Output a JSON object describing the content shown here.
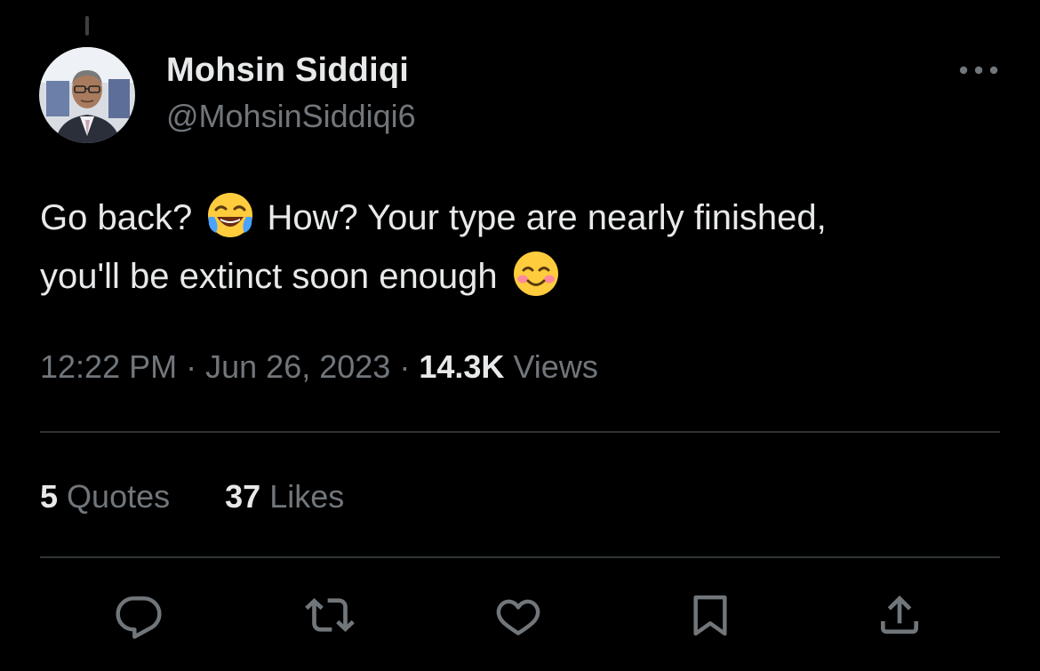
{
  "author": {
    "display_name": "Mohsin Siddiqi",
    "handle": "@MohsinSiddiqi6"
  },
  "tweet": {
    "text_line1_a": "Go back?",
    "emoji1": "face-with-tears-of-joy",
    "text_line1_b": "How? Your type are nearly finished,",
    "text_line2": "you'll be extinct soon enough",
    "emoji2": "smiling-face-with-blush"
  },
  "meta": {
    "time": "12:22 PM",
    "separator": "·",
    "date": "Jun 26, 2023",
    "views_count": "14.3K",
    "views_label": "Views"
  },
  "stats": {
    "quotes_count": "5",
    "quotes_label": "Quotes",
    "likes_count": "37",
    "likes_label": "Likes"
  },
  "actions": {
    "icons": [
      "reply-icon",
      "retweet-icon",
      "like-icon",
      "bookmark-icon",
      "share-icon"
    ]
  },
  "colors": {
    "background": "#000000",
    "primary_text": "#e7e9ea",
    "secondary_text": "#71767b",
    "divider": "#2f3336"
  }
}
